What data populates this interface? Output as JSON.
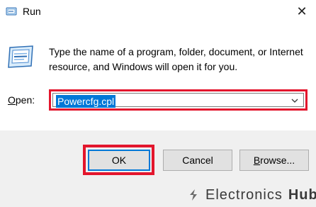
{
  "window": {
    "title": "Run",
    "close_glyph": "✕",
    "app_icon": "run-icon"
  },
  "body": {
    "icon": "run-icon",
    "description": "Type the name of a program, folder, document, or Internet resource, and Windows will open it for you."
  },
  "open_field": {
    "label_prefix": "",
    "label_underlined": "O",
    "label_rest": "pen:",
    "value": "Powercfg.cpl",
    "dropdown_icon": "chevron-down-icon"
  },
  "buttons": {
    "ok": "OK",
    "cancel": "Cancel",
    "browse_underlined": "B",
    "browse_rest": "rowse..."
  },
  "watermark": {
    "brand_a": "Electronics",
    "brand_b": "Hub"
  },
  "colors": {
    "highlight_red": "#e3162d",
    "selection_blue": "#0078d7",
    "footer_gray": "#f0f0f0"
  }
}
